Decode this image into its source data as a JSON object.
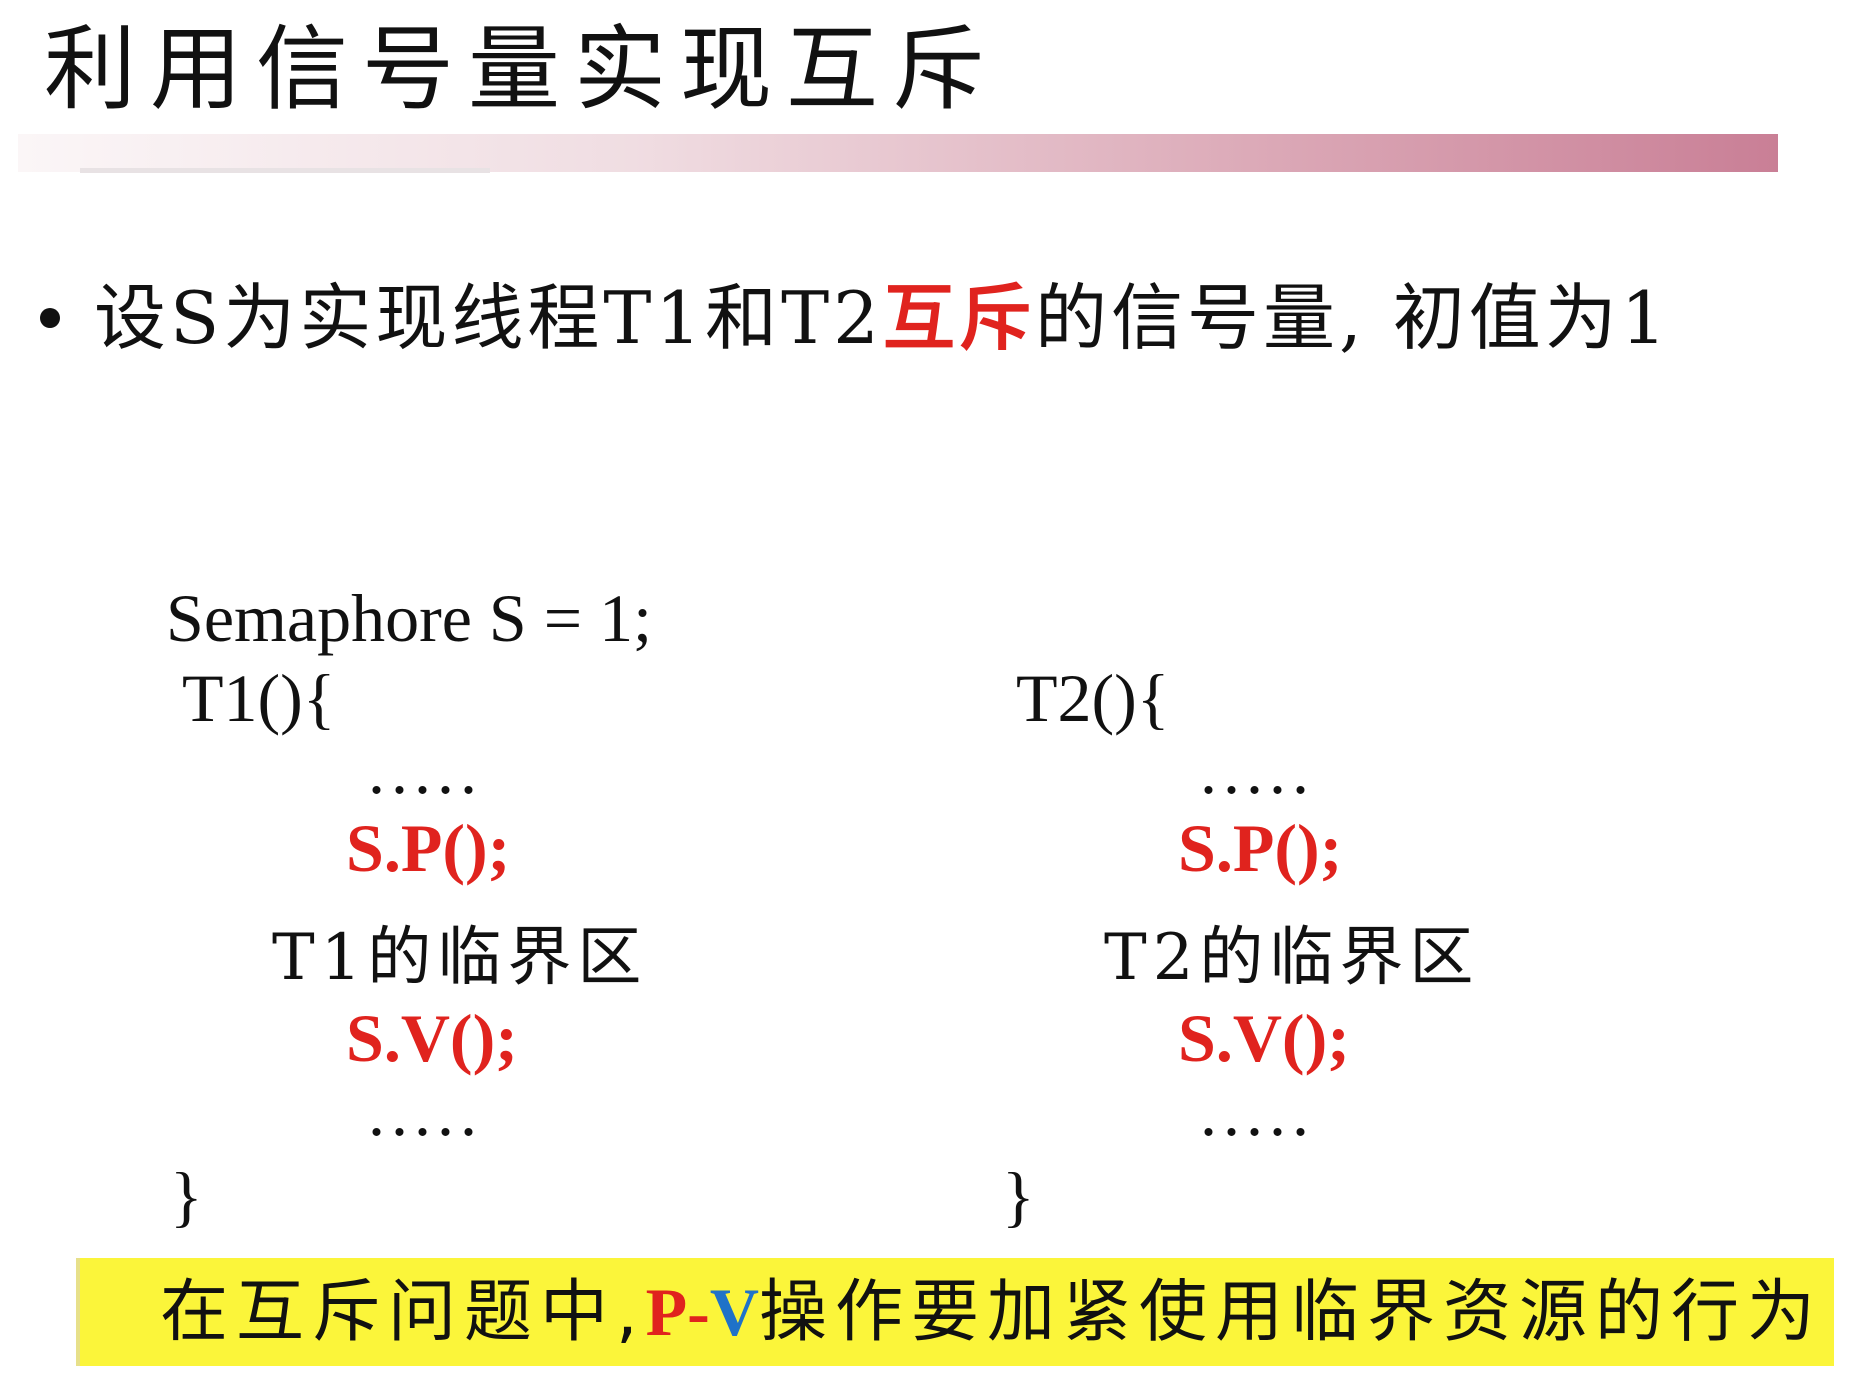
{
  "title": "利用信号量实现互斥",
  "bullet": {
    "prefix": "设S为实现线程T1和T2",
    "highlight": "互斥",
    "suffix": "的信号量, 初值为1"
  },
  "code": {
    "declaration": "Semaphore S = 1;",
    "thread1": {
      "header": "T1(){",
      "dots_before": ".....",
      "p_op": "S.P();",
      "critical": "T1的临界区",
      "v_op": "S.V();",
      "dots_after": ".....",
      "close": "}"
    },
    "thread2": {
      "header": "T2(){",
      "dots_before": ".....",
      "p_op": "S.P();",
      "critical": "T2的临界区",
      "v_op": "S.V();",
      "dots_after": ".....",
      "close": "}"
    }
  },
  "note": {
    "prefix": "在互斥问题中,",
    "p": "P",
    "dash": "-",
    "v": "V",
    "suffix": "操作要加紧使用临界资源的行为"
  },
  "colors": {
    "highlight_red": "#e0231e",
    "v_blue": "#1f72c8",
    "note_background": "#fbf53a",
    "title_bar_end": "#c97f96"
  }
}
